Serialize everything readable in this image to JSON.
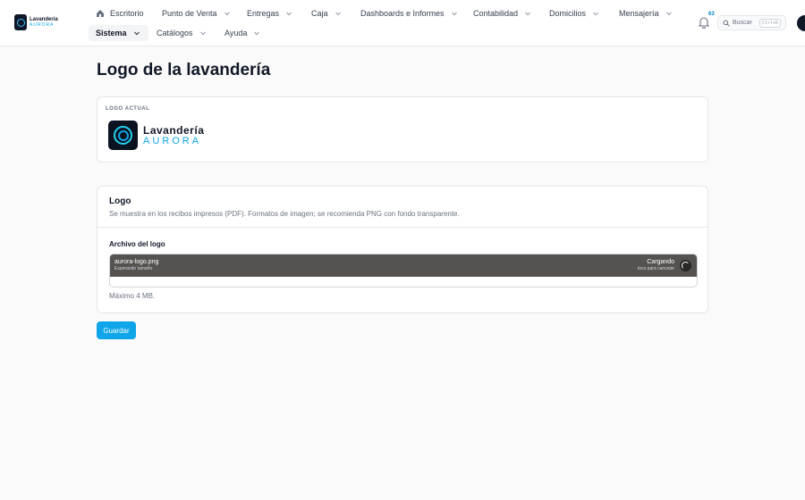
{
  "brand": {
    "name": "Lavandería",
    "sub": "AURORA"
  },
  "nav": {
    "home": "Escritorio",
    "items": [
      {
        "label": "Punto de Venta"
      },
      {
        "label": "Entregas"
      },
      {
        "label": "Caja"
      },
      {
        "label": "Dashboards e Informes"
      },
      {
        "label": "Contabilidad"
      },
      {
        "label": "Domicilios"
      },
      {
        "label": "Mensajería"
      }
    ],
    "row2": [
      {
        "label": "Sistema",
        "active": true
      },
      {
        "label": "Catálogos"
      },
      {
        "label": "Ayuda"
      }
    ]
  },
  "notifications": {
    "count": "63"
  },
  "search": {
    "label": "Buscar",
    "shortcut": "Ctrl+K"
  },
  "page": {
    "title": "Logo de la lavandería"
  },
  "current_logo": {
    "heading": "LOGO ACTUAL",
    "logo_word1": "Lavandería",
    "logo_word2": "AURORA"
  },
  "logo_section": {
    "title": "Logo",
    "description": "Se muestra en los recibos impresos (PDF). Formatos de imagen; se recomienda PNG con fondo transparente.",
    "field_label": "Archivo del logo",
    "file_name": "aurora-logo.png",
    "file_sub": "Esperando tamaño",
    "status": "Cargando",
    "status_hint": "toca para cancelar",
    "max_size": "Máximo 4 MB."
  },
  "actions": {
    "save": "Guardar"
  },
  "colors": {
    "accent": "#0ea5e9",
    "upload_bar": "#565250"
  }
}
